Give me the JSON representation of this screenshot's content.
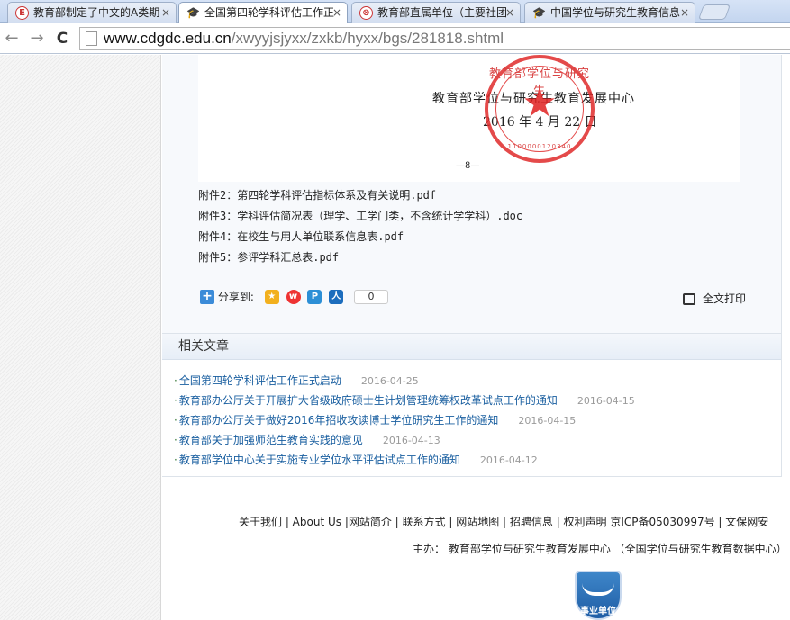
{
  "browser": {
    "tabs": [
      {
        "title": "教育部制定了中文的A类期",
        "favicon": "E",
        "active": false
      },
      {
        "title": "全国第四轮学科评估工作正",
        "favicon": "mortarboard",
        "active": true
      },
      {
        "title": "教育部直属单位（主要社团",
        "favicon": "seal",
        "active": false
      },
      {
        "title": "中国学位与研究生教育信息",
        "favicon": "mortarboard",
        "active": false
      }
    ],
    "close_glyph": "×",
    "back_glyph": "←",
    "forward_glyph": "→",
    "reload_glyph": "C",
    "url_host": "www.cdgdc.edu.cn",
    "url_path": "/xwyyjsjyxx/zxkb/hyxx/bgs/281818.shtml"
  },
  "document_image": {
    "org_name": "教育部学位与研究生教育发展中心",
    "date": "2016 年 4 月 22 日",
    "page_number": "—8—",
    "stamp_text": "教育部学位与研究生教育发展中心",
    "stamp_number": "1100000120340"
  },
  "attachments": [
    "附件2：第四轮学科评估指标体系及有关说明.pdf",
    "附件3：学科评估简况表（理学、工学门类，不含统计学学科）.doc",
    "附件4：在校生与用人单位联系信息表.pdf",
    "附件5：参评学科汇总表.pdf"
  ],
  "share": {
    "label": "分享到:",
    "count": "0",
    "icons": [
      "qzone-icon",
      "weibo-icon",
      "qq-icon",
      "renren-icon"
    ]
  },
  "print_label": "全文打印",
  "related": {
    "title": "相关文章",
    "items": [
      {
        "title": "全国第四轮学科评估工作正式启动",
        "date": "2016-04-25"
      },
      {
        "title": "教育部办公厅关于开展扩大省级政府硕士生计划管理统筹权改革试点工作的通知",
        "date": "2016-04-15"
      },
      {
        "title": "教育部办公厅关于做好2016年招收攻读博士学位研究生工作的通知",
        "date": "2016-04-15"
      },
      {
        "title": "教育部关于加强师范生教育实践的意见",
        "date": "2016-04-13"
      },
      {
        "title": "教育部学位中心关于实施专业学位水平评估试点工作的通知",
        "date": "2016-04-12"
      }
    ]
  },
  "footer": {
    "links_line": "关于我们 | About Us |网站简介 | 联系方式 | 网站地图 | 招聘信息 | 权利声明 京ICP备05030997号 | 文保网安",
    "host_line": "主办： 教育部学位与研究生教育发展中心 （全国学位与研究生教育数据中心）",
    "badge_text": "事业单位"
  },
  "colors": {
    "link": "#1a5fa0",
    "stamp_red": "#e02b2b",
    "badge_blue": "#2a6fb5"
  }
}
